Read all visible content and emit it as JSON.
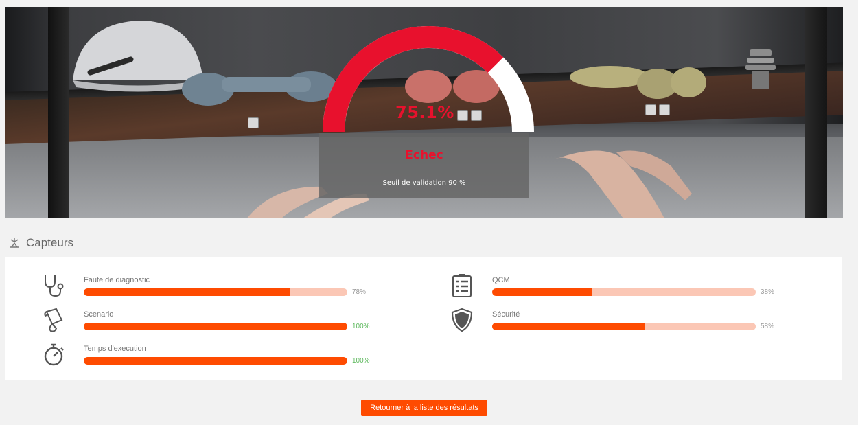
{
  "hero": {
    "score_percent": 75.1,
    "score_text": "75.1%",
    "verdict": "Echec",
    "threshold_text": "Seuil de validation 90 %",
    "gauge_color": "#e8112d"
  },
  "section": {
    "title": "Capteurs",
    "icon": "satellite-dish-icon"
  },
  "sensors": [
    {
      "label": "Faute de diagnostic",
      "value": 78,
      "value_text": "78%",
      "icon": "stethoscope-icon",
      "status": "partial"
    },
    {
      "label": "Scenario",
      "value": 100,
      "value_text": "100%",
      "icon": "scroll-icon",
      "status": "ok"
    },
    {
      "label": "Temps d'execution",
      "value": 100,
      "value_text": "100%",
      "icon": "stopwatch-icon",
      "status": "ok"
    },
    {
      "label": "QCM",
      "value": 38,
      "value_text": "38%",
      "icon": "clipboard-list-icon",
      "status": "partial"
    },
    {
      "label": "Sécurité",
      "value": 58,
      "value_text": "58%",
      "icon": "shield-icon",
      "status": "partial"
    }
  ],
  "colors": {
    "accent": "#fe4b01",
    "bar_bg": "#fbc7b5",
    "ok": "#5cb85c",
    "fail": "#e8112d"
  },
  "actions": {
    "back_label": "Retourner à la liste des résultats"
  }
}
